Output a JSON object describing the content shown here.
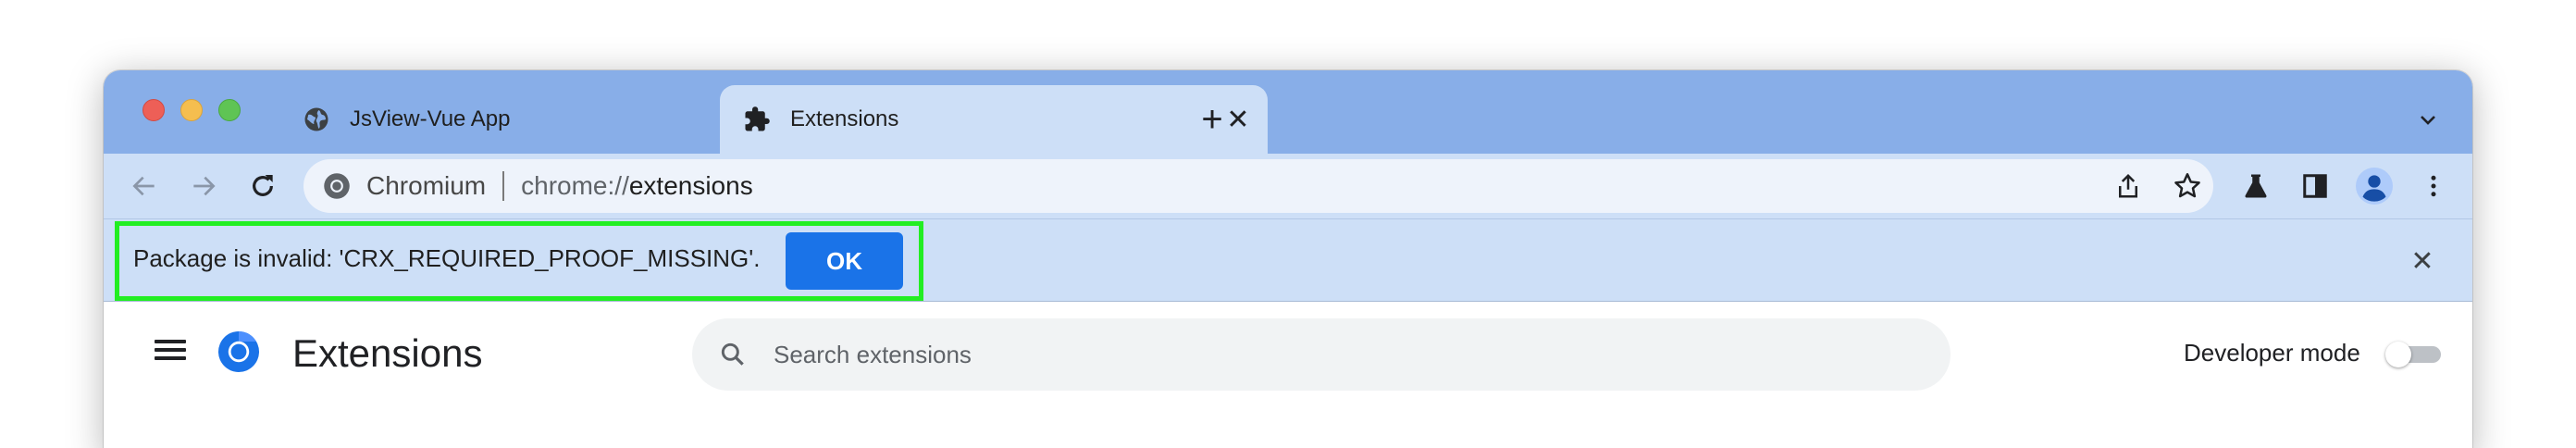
{
  "tabs": [
    {
      "title": "JsView-Vue App",
      "icon": "globe-icon",
      "active": false
    },
    {
      "title": "Extensions",
      "icon": "puzzle-icon",
      "active": true
    }
  ],
  "tab_close_glyph": "✕",
  "new_tab_glyph": "+",
  "omnibox": {
    "site_name": "Chromium",
    "url_scheme": "chrome://",
    "url_host": "extensions"
  },
  "infobar": {
    "message": "Package is invalid: 'CRX_REQUIRED_PROOF_MISSING'.",
    "ok_label": "OK",
    "close_glyph": "✕"
  },
  "extensions_page": {
    "title": "Extensions",
    "search_placeholder": "Search extensions",
    "developer_mode_label": "Developer mode",
    "developer_mode_on": false
  },
  "colors": {
    "tabstrip": "#88aee8",
    "toolbar": "#cddff7",
    "ok_button": "#1a73e8",
    "highlight": "#22ee22"
  }
}
